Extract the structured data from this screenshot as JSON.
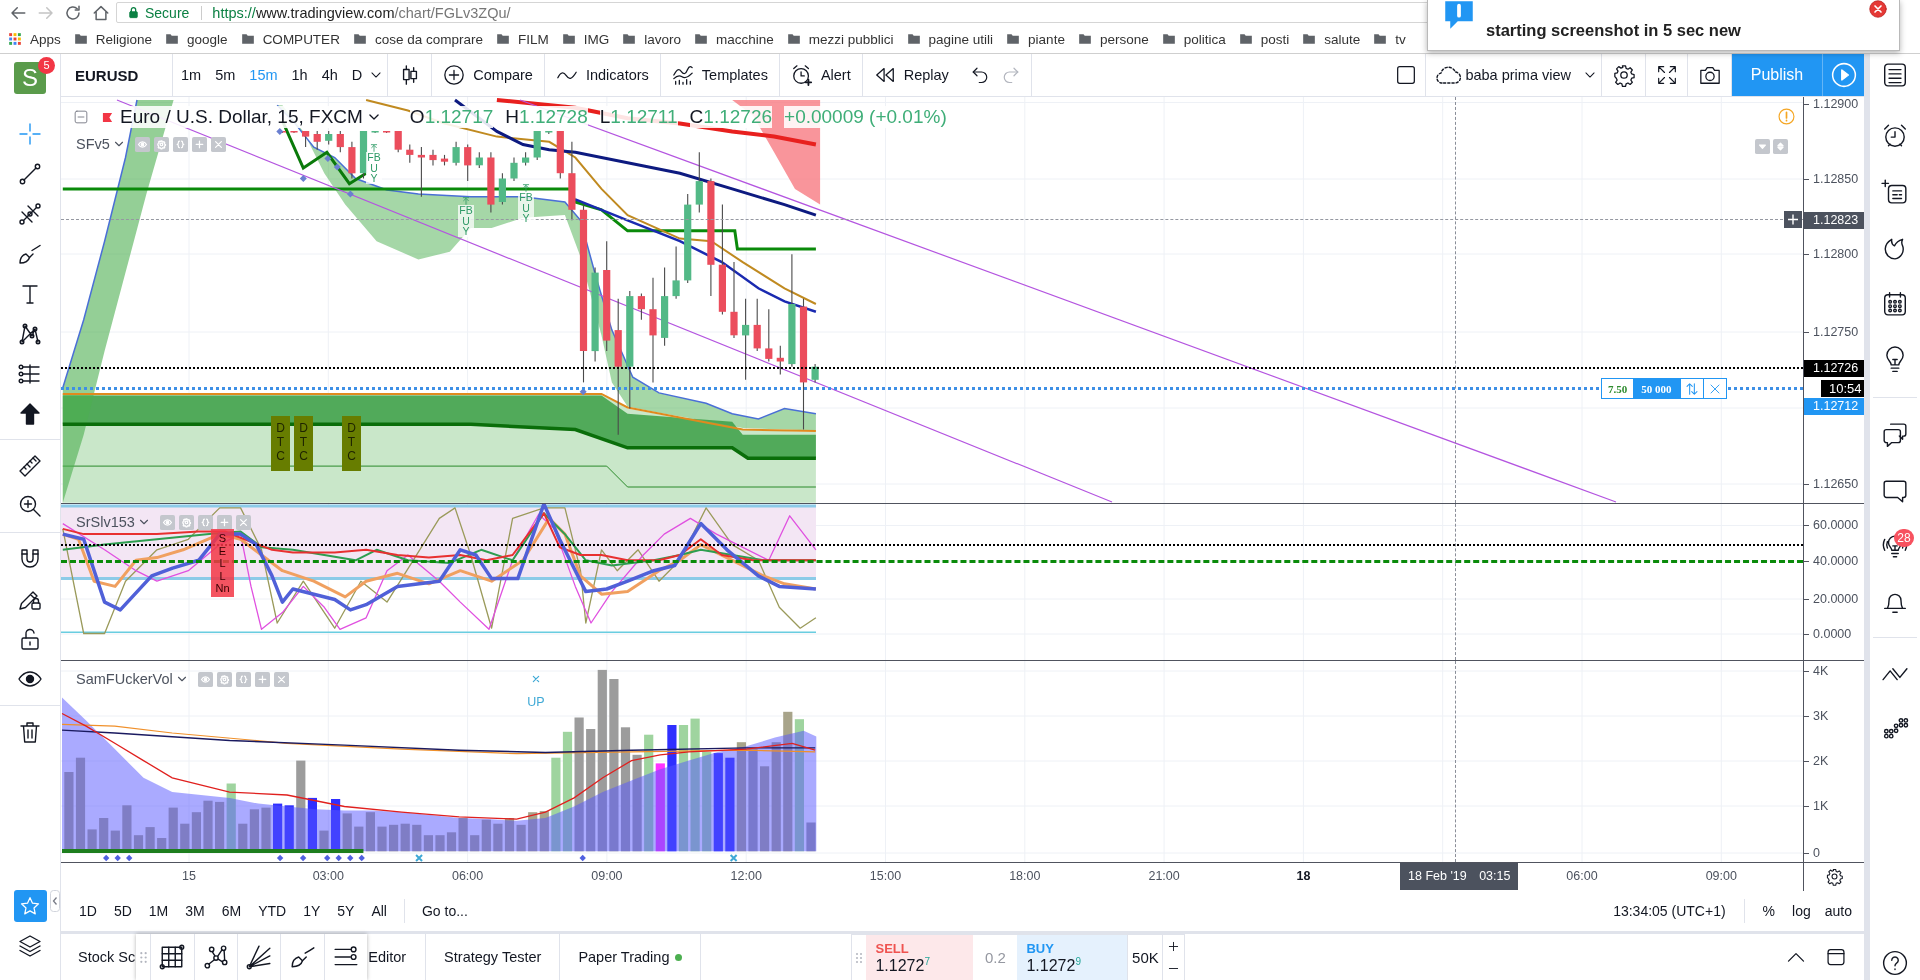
{
  "browser": {
    "nav": {
      "back_disabled": false,
      "forward_disabled": true
    },
    "address": {
      "secure_label": "Secure",
      "url": [
        {
          "kind": "scheme",
          "text": "https://"
        },
        {
          "kind": "host",
          "text": "www.tradingview.com"
        },
        {
          "kind": "path",
          "text": "/chart/FGLv3ZQu/"
        }
      ]
    },
    "bookmarks": [
      {
        "kind": "apps",
        "label": "Apps"
      },
      {
        "kind": "folder",
        "label": "Religione"
      },
      {
        "kind": "folder",
        "label": "google"
      },
      {
        "kind": "folder",
        "label": "COMPUTER"
      },
      {
        "kind": "folder",
        "label": "cose da comprare"
      },
      {
        "kind": "folder",
        "label": "FILM"
      },
      {
        "kind": "folder",
        "label": "IMG"
      },
      {
        "kind": "folder",
        "label": "lavoro"
      },
      {
        "kind": "folder",
        "label": "macchine"
      },
      {
        "kind": "folder",
        "label": "mezzi pubblici"
      },
      {
        "kind": "folder",
        "label": "pagine utili"
      },
      {
        "kind": "folder",
        "label": "piante"
      },
      {
        "kind": "folder",
        "label": "persone"
      },
      {
        "kind": "folder",
        "label": "politica"
      },
      {
        "kind": "folder",
        "label": "posti"
      },
      {
        "kind": "folder",
        "label": "salute"
      },
      {
        "kind": "folder",
        "label": "tv"
      }
    ]
  },
  "notification": {
    "text": "starting screenshot in 5 sec new"
  },
  "left_toolbar": {
    "logo": "S",
    "logo_badge": "5",
    "tools": [
      {
        "selected": true
      },
      {
        "selected": false
      },
      {
        "selected": false
      },
      {
        "selected": false
      },
      {
        "selected": false
      },
      {
        "selected": false
      },
      {
        "selected": false
      },
      {
        "selected": false
      },
      {
        "selected": false
      },
      {
        "selected": false
      },
      {
        "selected": false
      },
      {
        "selected": false
      },
      {
        "selected": false
      },
      {
        "selected": false
      },
      {
        "selected": false
      }
    ],
    "favorites_on": true
  },
  "top_toolbar": {
    "symbol": "EURUSD",
    "intervals": [
      {
        "label": "1m",
        "selected": false
      },
      {
        "label": "5m",
        "selected": false
      },
      {
        "label": "15m",
        "selected": true
      },
      {
        "label": "1h",
        "selected": false
      },
      {
        "label": "4h",
        "selected": false
      },
      {
        "label": "D",
        "selected": false
      }
    ],
    "buttons": [
      "Compare",
      "Indicators",
      "Templates",
      "Alert",
      "Replay"
    ],
    "undo_disabled": false,
    "redo_disabled": true,
    "layout_name": "baba prima view",
    "publish": "Publish"
  },
  "chart": {
    "main_pane": {
      "legend": {
        "title": "Euro / U.S. Dollar, 15, FXCM",
        "ohlc": [
          {
            "letter": "O",
            "value": "1.12717"
          },
          {
            "letter": "H",
            "value": "1.12728"
          },
          {
            "letter": "L",
            "value": "1.12711"
          },
          {
            "letter": "C",
            "value": "1.12726"
          }
        ],
        "change": "+0.00009 (+0.01%)"
      },
      "study": "SFv5",
      "markers": [
        {
          "kind": "buy",
          "text": "FB\nU\nY"
        },
        {
          "kind": "buy",
          "text": "FB\nU\nY"
        },
        {
          "kind": "buy",
          "text": "FB\nU\nY"
        },
        {
          "kind": "dtc",
          "text": "D\nT\nC"
        },
        {
          "kind": "dtc",
          "text": "D\nT\nC"
        },
        {
          "kind": "dtc",
          "text": "D\nT\nC"
        }
      ],
      "order": {
        "value": "7.50",
        "quantity": "50 000"
      },
      "price_axis": [
        {
          "kind": "tick",
          "text": "1.12900"
        },
        {
          "kind": "tick",
          "text": "1.12850"
        },
        {
          "kind": "crosshair",
          "text": "1.12823"
        },
        {
          "kind": "tick",
          "text": "1.12800"
        },
        {
          "kind": "tick",
          "text": "1.12750"
        },
        {
          "kind": "last",
          "text": "1.12726"
        },
        {
          "kind": "countdown",
          "text": "10:54"
        },
        {
          "kind": "order",
          "text": "1.12712"
        },
        {
          "kind": "tick",
          "text": "1.12650"
        }
      ]
    },
    "oscillator_pane": {
      "study": "SrSlv153",
      "markers": [
        {
          "kind": "sell",
          "text": "S\nE\nL\nL\nNn"
        }
      ],
      "axis": [
        "60.0000",
        "40.0000",
        "20.0000",
        "0.0000"
      ]
    },
    "volume_pane": {
      "study": "SamFUckerVol",
      "markers": [
        {
          "kind": "up",
          "text": "UP"
        }
      ],
      "axis": [
        "4K",
        "3K",
        "2K",
        "1K",
        "0"
      ]
    },
    "time_axis": {
      "labels": [
        {
          "kind": "minor",
          "text": "15"
        },
        {
          "kind": "minor",
          "text": "03:00"
        },
        {
          "kind": "minor",
          "text": "06:00"
        },
        {
          "kind": "minor",
          "text": "09:00"
        },
        {
          "kind": "minor",
          "text": "12:00"
        },
        {
          "kind": "minor",
          "text": "15:00"
        },
        {
          "kind": "minor",
          "text": "18:00"
        },
        {
          "kind": "minor",
          "text": "21:00"
        },
        {
          "kind": "major",
          "text": "18"
        },
        {
          "kind": "minor",
          "text": "06:00"
        },
        {
          "kind": "minor",
          "text": "09:00"
        }
      ],
      "crosshair": {
        "date": "18 Feb '19",
        "time": "03:15"
      }
    }
  },
  "range_bar": {
    "ranges": [
      "1D",
      "5D",
      "1M",
      "3M",
      "6M",
      "YTD",
      "1Y",
      "5Y",
      "All"
    ],
    "goto": "Go to...",
    "clock": "13:34:05 (UTC+1)",
    "scale_options": [
      "%",
      "log",
      "auto"
    ]
  },
  "bottom_panel": {
    "tabs": [
      {
        "label": "Stock Sc"
      },
      {
        "label": "Editor"
      },
      {
        "label": "Strategy Tester"
      },
      {
        "label": "Paper Trading",
        "color": "#4caf50"
      }
    ],
    "trading": {
      "sell": {
        "label": "SELL",
        "price": "1.1272$^{7}$"
      },
      "spread": "0.2",
      "buy": {
        "label": "BUY",
        "price": "1.1272$^{9}$"
      },
      "quantity": "50K"
    }
  },
  "right_sidebar": {
    "ideas_badge": "28"
  }
}
